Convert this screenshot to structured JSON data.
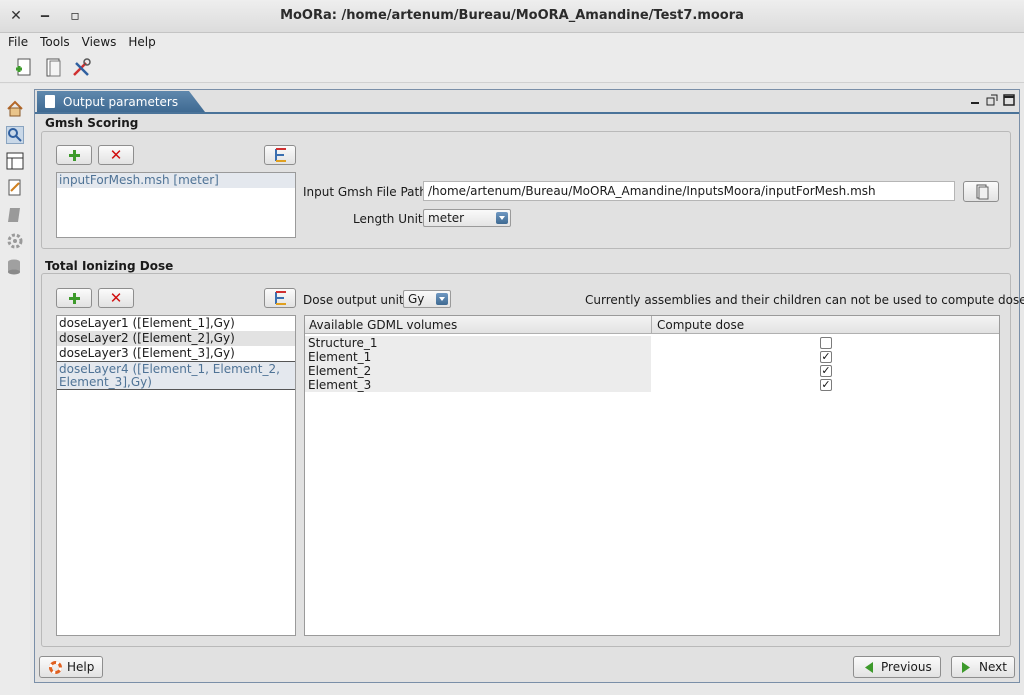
{
  "window": {
    "title": "MoORa: /home/artenum/Bureau/MoORA_Amandine/Test7.moora",
    "close_glyph": "✕",
    "minimize_glyph": "‒",
    "maximize_glyph": "▫"
  },
  "menu": [
    "File",
    "Tools",
    "Views",
    "Help"
  ],
  "toolbar": {
    "icons": [
      "new-project-icon",
      "open-document-icon",
      "tools-wrench-icon"
    ]
  },
  "sidebar": {
    "icons": [
      "home-icon",
      "search-icon",
      "layout-icon",
      "document-edit-icon",
      "report-icon",
      "gear-icon",
      "database-icon"
    ]
  },
  "tab": {
    "label": "Output parameters"
  },
  "gmsh": {
    "title": "Gmsh Scoring",
    "list": [
      "inputForMesh.msh [meter]"
    ],
    "input_path_label": "Input Gmsh File Path",
    "input_path_value": "/home/artenum/Bureau/MoORA_Amandine/InputsMoora/inputForMesh.msh",
    "length_unit_label": "Length Unit",
    "length_unit_value": "meter"
  },
  "dose": {
    "title": "Total Ionizing Dose",
    "output_unit_label": "Dose output unit",
    "output_unit_value": "Gy",
    "notice": "Currently assemblies and their children can not be used to compute dose.",
    "layers": [
      "doseLayer1 ([Element_1],Gy)",
      "doseLayer2 ([Element_2],Gy)",
      "doseLayer3 ([Element_3],Gy)",
      "doseLayer4 ([Element_1, Element_2, Element_3],Gy)"
    ],
    "table": {
      "columns": [
        "Available GDML volumes",
        "Compute dose"
      ],
      "rows": [
        {
          "volume": "Structure_1",
          "compute": false
        },
        {
          "volume": "Element_1",
          "compute": true
        },
        {
          "volume": "Element_2",
          "compute": true
        },
        {
          "volume": "Element_3",
          "compute": true
        }
      ]
    }
  },
  "footer": {
    "help_label": "Help",
    "previous_label": "Previous",
    "next_label": "Next"
  },
  "colors": {
    "tab_accent": "#4a7399",
    "add_green": "#3d9a2b",
    "remove_red": "#d01010",
    "selected_text": "#4f7396"
  }
}
